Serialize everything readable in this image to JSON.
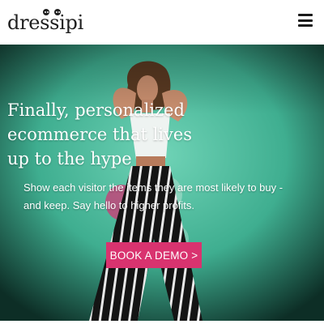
{
  "header": {
    "logo_text": "dressipi",
    "menu_icon": "hamburger-menu-icon"
  },
  "hero": {
    "title": "Finally, personalized ecommerce that lives up to the hype",
    "subtitle": "Show each visitor the items they are most likely to buy - and keep. Say hello to higher profits.",
    "cta_label": "BOOK A DEMO >"
  },
  "colors": {
    "accent": "#d9336f",
    "hero_background": "#45b89a",
    "text_dark": "#1f1f1f"
  }
}
